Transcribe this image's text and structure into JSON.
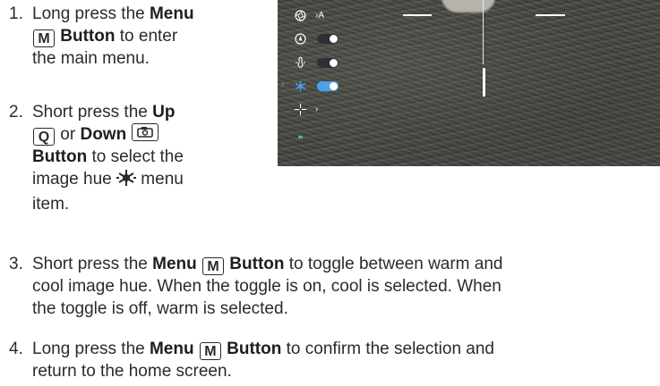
{
  "steps": [
    {
      "num": "1.",
      "lines": [
        "Long press the",
        "Menu",
        "M",
        "Button",
        "to enter",
        "the main menu."
      ]
    },
    {
      "num": "2.",
      "t1": "Short press the",
      "t_up": "Up",
      "k_up": "Q",
      "t_or": "or",
      "t_down": "Down",
      "t_btn": "Button",
      "t2": "to select the",
      "t3": "image hue",
      "t4": "menu",
      "t5": "item."
    },
    {
      "num": "3.",
      "t1": "Short press the",
      "menu": "Menu",
      "key": "M",
      "btn": "Button",
      "t2": "to toggle between warm and",
      "line2": "cool image hue. When the toggle is on, cool is selected. When",
      "line3": "the toggle is off, warm is selected."
    },
    {
      "num": "4.",
      "t1": "Long press the",
      "menu": "Menu",
      "key": "M",
      "btn": "Button",
      "t2": "to confirm the selection and",
      "line2": "return to the home screen."
    }
  ],
  "screen": {
    "menu_items": [
      {
        "icon": "aperture-icon",
        "value": "›A"
      },
      {
        "icon": "compass-icon",
        "toggle": "on-white"
      },
      {
        "icon": "temperature-icon",
        "toggle": "on-white"
      },
      {
        "icon": "hue-icon",
        "toggle": "on-blue",
        "selected": true
      },
      {
        "icon": "crosshair-icon",
        "value": "›"
      }
    ],
    "selected_marker": "›"
  },
  "colors": {
    "accent": "#4aa3e8",
    "text": "#2b2b2b"
  }
}
